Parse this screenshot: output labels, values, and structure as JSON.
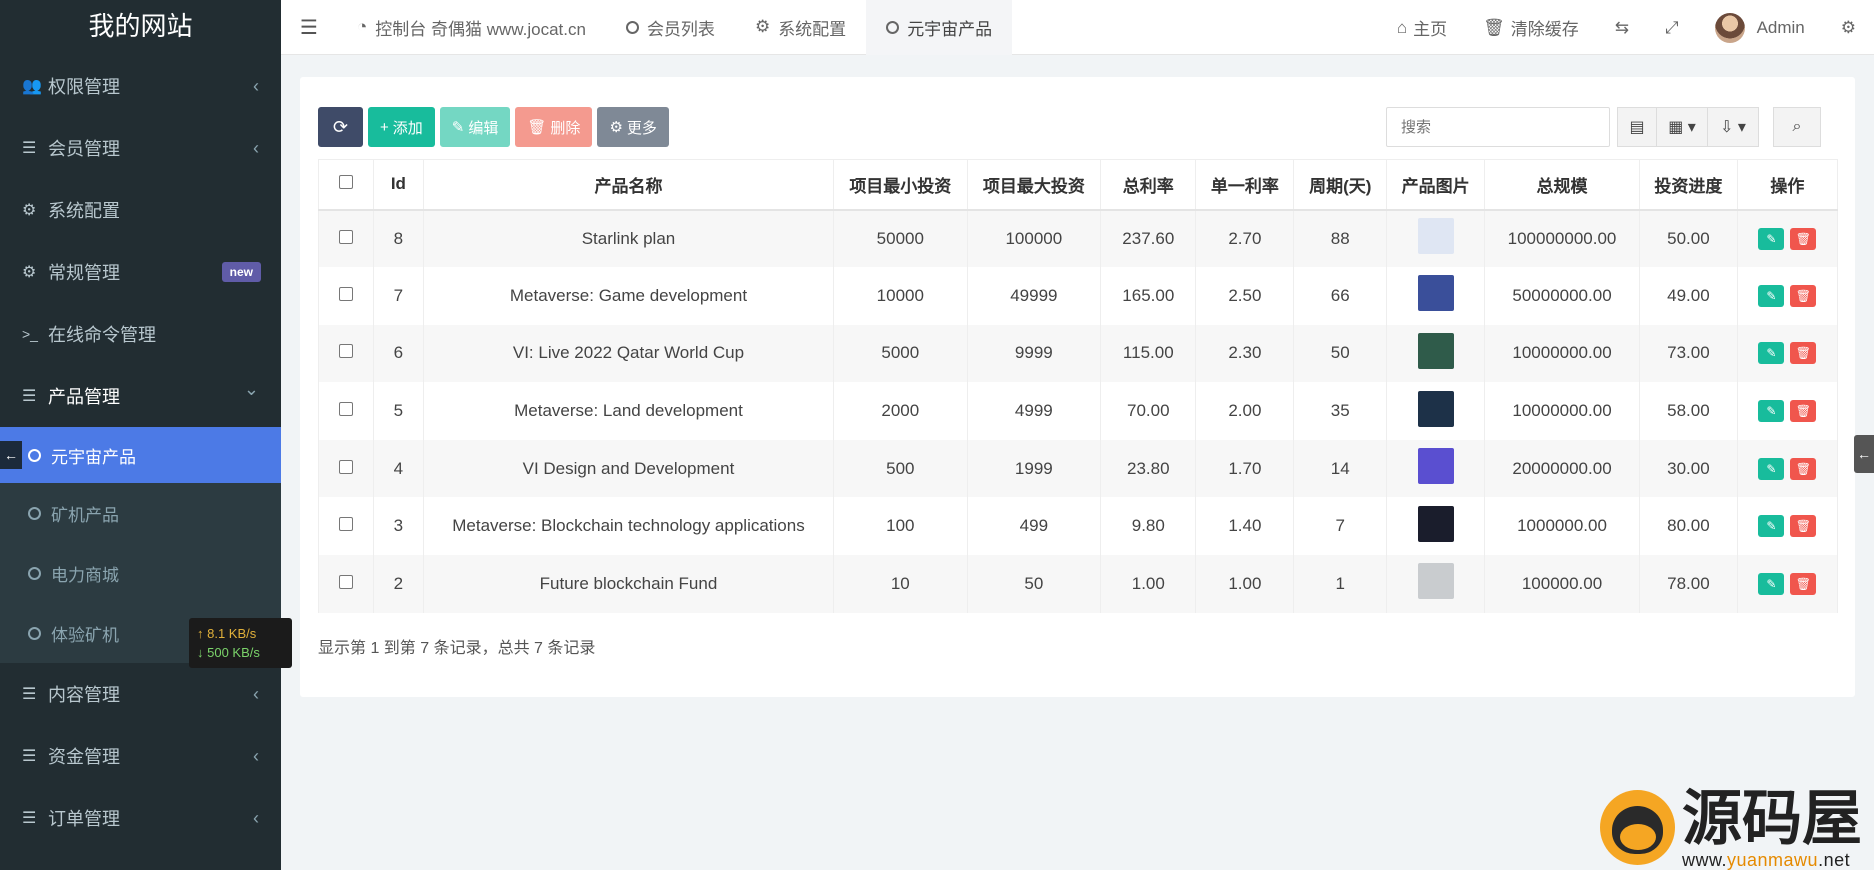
{
  "brand": "我的网站",
  "sidebar": {
    "items": [
      {
        "label": "权限管理",
        "icon": "users-icon",
        "chevron": "‹"
      },
      {
        "label": "会员管理",
        "icon": "list-icon",
        "chevron": "‹"
      },
      {
        "label": "系统配置",
        "icon": "gear-icon"
      },
      {
        "label": "常规管理",
        "icon": "gears-icon",
        "badge": "new"
      },
      {
        "label": "在线命令管理",
        "icon": "terminal-icon"
      },
      {
        "label": "产品管理",
        "icon": "list-icon",
        "chevron": "⌄"
      }
    ],
    "sub_items": [
      {
        "label": "元宇宙产品",
        "active": true
      },
      {
        "label": "矿机产品"
      },
      {
        "label": "电力商城"
      },
      {
        "label": "体验矿机"
      }
    ],
    "bottom_items": [
      {
        "label": "内容管理",
        "icon": "list-icon",
        "chevron": "‹"
      },
      {
        "label": "资金管理",
        "icon": "list-icon",
        "chevron": "‹"
      },
      {
        "label": "订单管理",
        "icon": "list-icon",
        "chevron": "‹"
      }
    ]
  },
  "net_speed": {
    "up": "↑ 8.1 KB/s",
    "down": "↓ 500 KB/s"
  },
  "topbar": {
    "tabs": [
      {
        "label": "控制台 奇偶猫 www.jocat.cn",
        "icon": "dashboard-icon"
      },
      {
        "label": "会员列表",
        "icon": "circle-icon"
      },
      {
        "label": "系统配置",
        "icon": "gear-icon"
      },
      {
        "label": "元宇宙产品",
        "icon": "circle-icon",
        "active": true
      }
    ],
    "home": "主页",
    "clear_cache": "清除缓存",
    "user": "Admin"
  },
  "toolbar": {
    "add": "添加",
    "edit": "编辑",
    "delete": "删除",
    "more": "更多",
    "search_placeholder": "搜索"
  },
  "table": {
    "headers": [
      "Id",
      "产品名称",
      "项目最小投资",
      "项目最大投资",
      "总利率",
      "单一利率",
      "周期(天)",
      "产品图片",
      "总规模",
      "投资进度",
      "操作"
    ],
    "rows": [
      {
        "id": "8",
        "name": "Starlink plan",
        "min": "50000",
        "max": "100000",
        "total_rate": "237.60",
        "rate": "2.70",
        "days": "88",
        "scale": "100000000.00",
        "progress": "50.00",
        "thumb_color": "#dfe6f3"
      },
      {
        "id": "7",
        "name": "Metaverse: Game development",
        "min": "10000",
        "max": "49999",
        "total_rate": "165.00",
        "rate": "2.50",
        "days": "66",
        "scale": "50000000.00",
        "progress": "49.00",
        "thumb_color": "#3a4f9a"
      },
      {
        "id": "6",
        "name": "VI: Live 2022 Qatar World Cup",
        "min": "5000",
        "max": "9999",
        "total_rate": "115.00",
        "rate": "2.30",
        "days": "50",
        "scale": "10000000.00",
        "progress": "73.00",
        "thumb_color": "#2f5b4a"
      },
      {
        "id": "5",
        "name": "Metaverse: Land development",
        "min": "2000",
        "max": "4999",
        "total_rate": "70.00",
        "rate": "2.00",
        "days": "35",
        "scale": "10000000.00",
        "progress": "58.00",
        "thumb_color": "#1d3148"
      },
      {
        "id": "4",
        "name": "VI Design and Development",
        "min": "500",
        "max": "1999",
        "total_rate": "23.80",
        "rate": "1.70",
        "days": "14",
        "scale": "20000000.00",
        "progress": "30.00",
        "thumb_color": "#5a4fd0"
      },
      {
        "id": "3",
        "name": "Metaverse: Blockchain technology applications",
        "min": "100",
        "max": "499",
        "total_rate": "9.80",
        "rate": "1.40",
        "days": "7",
        "scale": "1000000.00",
        "progress": "80.00",
        "thumb_color": "#1a1d2c"
      },
      {
        "id": "2",
        "name": "Future blockchain Fund",
        "min": "10",
        "max": "50",
        "total_rate": "1.00",
        "rate": "1.00",
        "days": "1",
        "scale": "100000.00",
        "progress": "78.00",
        "thumb_color": "#c9cccf"
      }
    ]
  },
  "summary": "显示第 1 到第 7 条记录，总共 7 条记录",
  "watermark": {
    "text": "源码屋",
    "url_prefix": "www.",
    "url_main": "yuanmawu",
    "url_suffix": ".net"
  }
}
